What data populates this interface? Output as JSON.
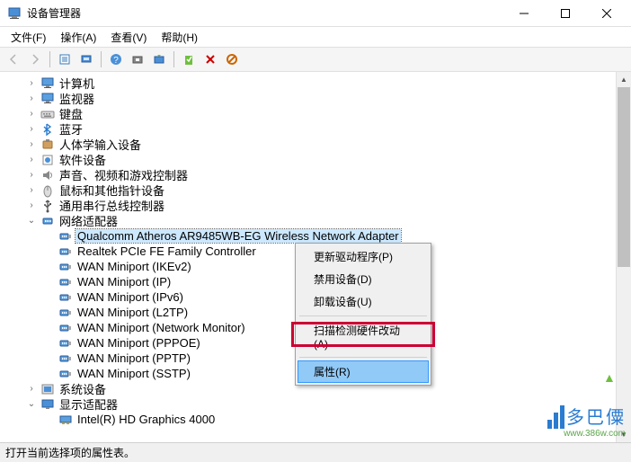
{
  "window": {
    "title": "设备管理器"
  },
  "menubar": {
    "items": [
      "文件(F)",
      "操作(A)",
      "查看(V)",
      "帮助(H)"
    ]
  },
  "tree": {
    "categories": [
      {
        "expander": "›",
        "icon": "monitor",
        "label": "计算机"
      },
      {
        "expander": "›",
        "icon": "monitor",
        "label": "监视器"
      },
      {
        "expander": "›",
        "icon": "keyboard",
        "label": "键盘"
      },
      {
        "expander": "›",
        "icon": "bluetooth",
        "label": "蓝牙"
      },
      {
        "expander": "›",
        "icon": "hid",
        "label": "人体学输入设备"
      },
      {
        "expander": "›",
        "icon": "software",
        "label": "软件设备"
      },
      {
        "expander": "›",
        "icon": "sound",
        "label": "声音、视频和游戏控制器"
      },
      {
        "expander": "›",
        "icon": "mouse",
        "label": "鼠标和其他指针设备"
      },
      {
        "expander": "›",
        "icon": "usb",
        "label": "通用串行总线控制器"
      },
      {
        "expander": "⌄",
        "icon": "network",
        "label": "网络适配器",
        "expanded": true,
        "children": [
          {
            "icon": "netadapter",
            "label": "Qualcomm Atheros AR9485WB-EG Wireless Network Adapter",
            "selected": true
          },
          {
            "icon": "netadapter",
            "label": "Realtek PCIe FE Family Controller"
          },
          {
            "icon": "netadapter",
            "label": "WAN Miniport (IKEv2)"
          },
          {
            "icon": "netadapter",
            "label": "WAN Miniport (IP)"
          },
          {
            "icon": "netadapter",
            "label": "WAN Miniport (IPv6)"
          },
          {
            "icon": "netadapter",
            "label": "WAN Miniport (L2TP)"
          },
          {
            "icon": "netadapter",
            "label": "WAN Miniport (Network Monitor)"
          },
          {
            "icon": "netadapter",
            "label": "WAN Miniport (PPPOE)"
          },
          {
            "icon": "netadapter",
            "label": "WAN Miniport (PPTP)"
          },
          {
            "icon": "netadapter",
            "label": "WAN Miniport (SSTP)"
          }
        ]
      },
      {
        "expander": "›",
        "icon": "system",
        "label": "系统设备"
      },
      {
        "expander": "⌄",
        "icon": "display",
        "label": "显示适配器",
        "expanded": true,
        "children": [
          {
            "icon": "displayadapter",
            "label": "Intel(R) HD Graphics 4000"
          }
        ]
      }
    ]
  },
  "context_menu": {
    "items": [
      {
        "label": "更新驱动程序(P)"
      },
      {
        "label": "禁用设备(D)"
      },
      {
        "label": "卸载设备(U)"
      },
      {
        "sep": true
      },
      {
        "label": "扫描检测硬件改动(A)"
      },
      {
        "sep": true
      },
      {
        "label": "属性(R)",
        "highlight": true
      }
    ]
  },
  "statusbar": {
    "text": "打开当前选择项的属性表。"
  },
  "watermark": {
    "brand": "多巴僳",
    "url": "www.386w.com"
  }
}
